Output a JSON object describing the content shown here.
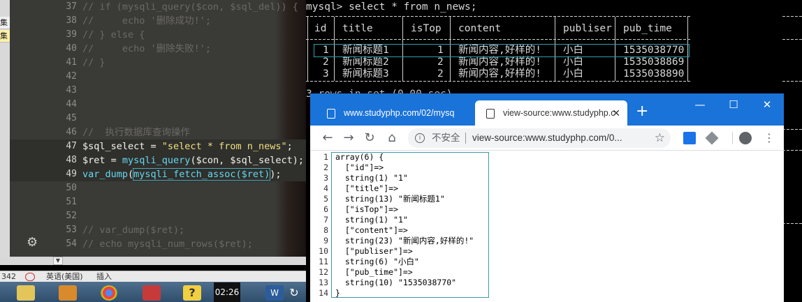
{
  "editor": {
    "lines": [
      {
        "num": "37",
        "text": "// if (mysqli_query($con, $sql_del)) {",
        "kind": "comment"
      },
      {
        "num": "38",
        "text": "//     echo '删除成功!';",
        "kind": "comment"
      },
      {
        "num": "39",
        "text": "// } else {",
        "kind": "comment"
      },
      {
        "num": "40",
        "text": "//     echo '删除失败!';",
        "kind": "comment"
      },
      {
        "num": "41",
        "text": "// }",
        "kind": "comment"
      },
      {
        "num": "42",
        "text": "",
        "kind": "blank"
      },
      {
        "num": "43",
        "text": "",
        "kind": "blank"
      },
      {
        "num": "44",
        "text": "",
        "kind": "blank"
      },
      {
        "num": "45",
        "text": "",
        "kind": "blank"
      },
      {
        "num": "46",
        "text": "//  执行数据库查询操作",
        "kind": "comment"
      },
      {
        "num": "47",
        "text": "$sql_select = \"select * from n_news\";",
        "kind": "code"
      },
      {
        "num": "48",
        "text": "$ret = mysqli_query($con, $sql_select);",
        "kind": "code"
      },
      {
        "num": "49",
        "text": "var_dump(mysqli_fetch_assoc($ret));",
        "kind": "code"
      },
      {
        "num": "50",
        "text": "",
        "kind": "blank"
      },
      {
        "num": "51",
        "text": "",
        "kind": "blank"
      },
      {
        "num": "52",
        "text": "",
        "kind": "blank"
      },
      {
        "num": "53",
        "text": "// var_dump($ret);",
        "kind": "comment"
      },
      {
        "num": "54",
        "text": "// echo mysqli_num_rows($ret);",
        "kind": "comment"
      }
    ],
    "line47": {
      "var": "$sql_select",
      "op": " = ",
      "str": "\"select * from n_news\"",
      "end": ";"
    },
    "line48": {
      "var": "$ret",
      "op": " = ",
      "fn": "mysqli_query",
      "args": "($con, $sql_select);"
    },
    "line49": {
      "fn": "var_dump",
      "open": "(",
      "inner": "mysqli_fetch_assoc($ret)",
      "close": ");"
    },
    "left_tabs": [
      "集",
      "集"
    ]
  },
  "statusbar": {
    "left": "342",
    "lang": "英语(美国)",
    "mode": "插入"
  },
  "taskbar": {
    "clock": "02:26"
  },
  "terminal": {
    "prompt": "mysql> select * from n_news;",
    "headers": [
      "id",
      "title",
      "isTop",
      "content",
      "publiser",
      "pub_time"
    ],
    "rows": [
      [
        "1",
        "新闻标题1",
        "1",
        "新闻内容,好样的!",
        "小白",
        "1535038770"
      ],
      [
        "2",
        "新闻标题2",
        "2",
        "新闻内容,好样的!",
        "小白",
        "1535038869"
      ],
      [
        "3",
        "新闻标题3",
        "2",
        "新闻内容,好样的!",
        "小白",
        "1535038890"
      ]
    ],
    "footer_partial": "3 rows in set (0.00 sec)"
  },
  "browser": {
    "tabs": [
      {
        "title": "www.studyphp.com/02/mysq",
        "active": false
      },
      {
        "title": "view-source:www.studyphp.c",
        "active": true
      }
    ],
    "new_tab": "+",
    "window_controls": {
      "min": "—",
      "max": "☐",
      "close": "✕"
    },
    "nav": {
      "back": "←",
      "forward": "→",
      "reload": "↻",
      "home": "⌂"
    },
    "omnibox": {
      "security_label": "不安全",
      "url": "view-source:www.studyphp.com/0..."
    },
    "source_lines": [
      {
        "n": "1",
        "t": "array(6) {"
      },
      {
        "n": "2",
        "t": "  [\"id\"]=>"
      },
      {
        "n": "3",
        "t": "  string(1) \"1\""
      },
      {
        "n": "4",
        "t": "  [\"title\"]=>"
      },
      {
        "n": "5",
        "t": "  string(13) \"新闻标题1\""
      },
      {
        "n": "6",
        "t": "  [\"isTop\"]=>"
      },
      {
        "n": "7",
        "t": "  string(1) \"1\""
      },
      {
        "n": "8",
        "t": "  [\"content\"]=>"
      },
      {
        "n": "9",
        "t": "  string(23) \"新闻内容,好样的!\""
      },
      {
        "n": "10",
        "t": "  [\"publiser\"]=>"
      },
      {
        "n": "11",
        "t": "  string(6) \"小白\""
      },
      {
        "n": "12",
        "t": "  [\"pub_time\"]=>"
      },
      {
        "n": "13",
        "t": "  string(10) \"1535038770\""
      },
      {
        "n": "14",
        "t": "}"
      }
    ]
  },
  "colors": {
    "editor_bg": "#3a3a37",
    "comment": "#6b6a63",
    "string": "#f0e180",
    "function": "#66d9ef",
    "chrome_blue": "#1a73d9",
    "highlight_border": "#2fa0b0"
  }
}
